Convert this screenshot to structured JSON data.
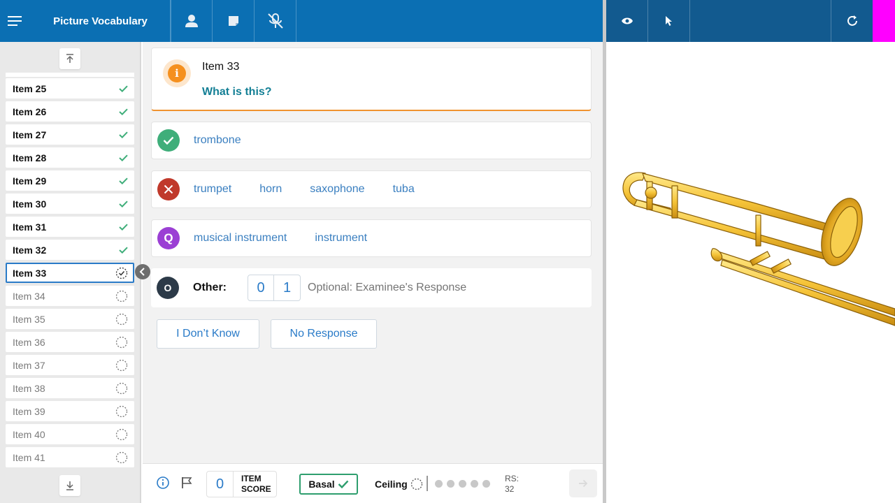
{
  "header": {
    "title": "Picture Vocabulary",
    "icons": [
      "menu-icon",
      "examinee-icon",
      "notes-icon",
      "mic-off-icon"
    ]
  },
  "right_header": {
    "icons": [
      "eye-icon",
      "pointer-icon",
      "refresh-icon"
    ],
    "accent_color": "#ff00ff"
  },
  "sidebar": {
    "items": [
      {
        "label": "Item 25",
        "status": "done"
      },
      {
        "label": "Item 26",
        "status": "done"
      },
      {
        "label": "Item 27",
        "status": "done"
      },
      {
        "label": "Item 28",
        "status": "done"
      },
      {
        "label": "Item 29",
        "status": "done"
      },
      {
        "label": "Item 30",
        "status": "done"
      },
      {
        "label": "Item 31",
        "status": "done"
      },
      {
        "label": "Item 32",
        "status": "done"
      },
      {
        "label": "Item 33",
        "status": "current"
      },
      {
        "label": "Item 34",
        "status": "todo"
      },
      {
        "label": "Item 35",
        "status": "todo"
      },
      {
        "label": "Item 36",
        "status": "todo"
      },
      {
        "label": "Item 37",
        "status": "todo"
      },
      {
        "label": "Item 38",
        "status": "todo"
      },
      {
        "label": "Item 39",
        "status": "todo"
      },
      {
        "label": "Item 40",
        "status": "todo"
      },
      {
        "label": "Item 41",
        "status": "todo"
      }
    ]
  },
  "question": {
    "item_title": "Item 33",
    "prompt": "What is this?",
    "info_glyph": "i"
  },
  "responses": {
    "correct": [
      "trombone"
    ],
    "incorrect": [
      "trumpet",
      "horn",
      "saxophone",
      "tuba"
    ],
    "query": [
      "musical instrument",
      "instrument"
    ],
    "query_glyph": "Q",
    "other_glyph": "O",
    "other_label": "Other:",
    "other_score_0": "0",
    "other_score_1": "1",
    "other_placeholder": "Optional: Examinee's Response"
  },
  "buttons": {
    "dont_know": "I Don’t Know",
    "no_response": "No Response"
  },
  "footer": {
    "item_score_value": "0",
    "item_score_label_1": "ITEM",
    "item_score_label_2": "SCORE",
    "basal_label": "Basal",
    "ceiling_label": "Ceiling",
    "rs_label": "RS:",
    "rs_value": "32",
    "ceiling_dots": 5
  },
  "colors": {
    "header_blue": "#0b6fb3",
    "header_dark_blue": "#125a8f",
    "correct_green": "#3fae7a",
    "incorrect_red": "#c0392b",
    "query_purple": "#9b3fd4",
    "other_dark": "#2c3a48",
    "info_orange": "#f5901e",
    "link_blue": "#3a7fc0",
    "prompt_teal": "#137f95"
  }
}
